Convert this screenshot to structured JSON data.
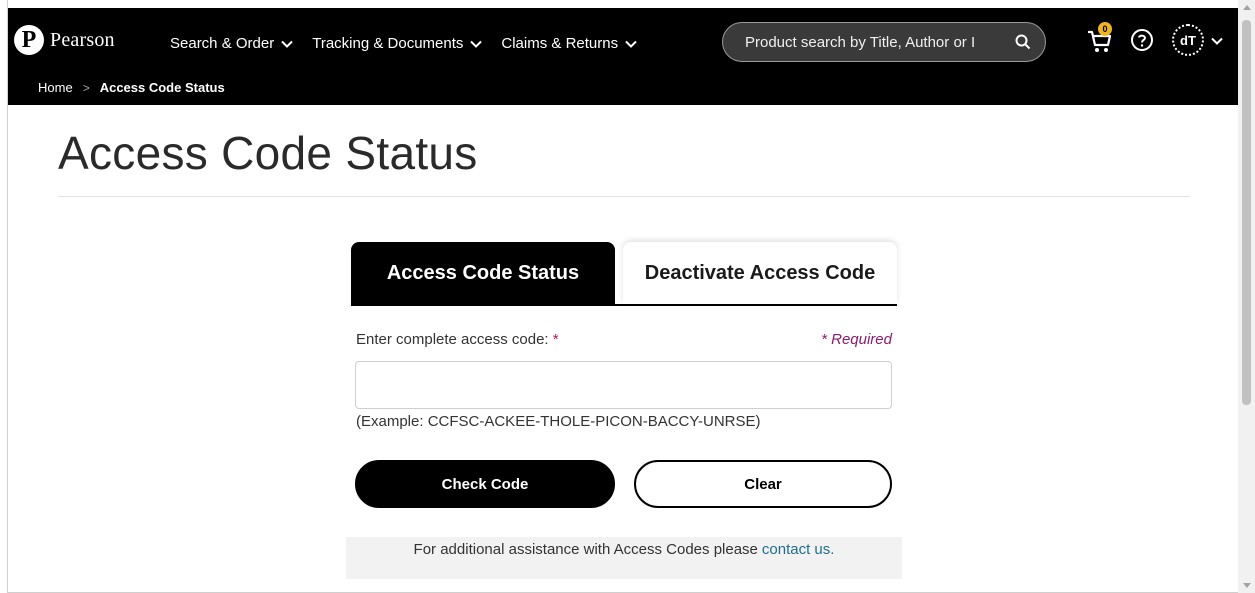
{
  "header": {
    "logo_mark": "P",
    "logo_text": "Pearson",
    "nav": [
      {
        "label": "Search & Order"
      },
      {
        "label": "Tracking & Documents"
      },
      {
        "label": "Claims & Returns"
      }
    ],
    "search_placeholder": "Product search by Title, Author or I",
    "cart_count": "0",
    "avatar_initials": "dT"
  },
  "breadcrumb": {
    "home": "Home",
    "separator": ">",
    "current": "Access Code Status"
  },
  "page": {
    "title": "Access Code Status"
  },
  "tabs": [
    {
      "label": "Access Code Status",
      "active": true
    },
    {
      "label": "Deactivate Access Code",
      "active": false
    }
  ],
  "form": {
    "label": "Enter complete access code:",
    "label_star": "*",
    "required_note": "* Required",
    "input_value": "",
    "example": "(Example: CCFSC-ACKEE-THOLE-PICON-BACCY-UNRSE)",
    "check_label": "Check Code",
    "clear_label": "Clear"
  },
  "assist": {
    "text": "For additional assistance with Access Codes please",
    "link": "contact us."
  },
  "colors": {
    "header_bg": "#000000",
    "link": "#1f6f8b",
    "required": "#8a1c6e",
    "badge": "#f0b323"
  },
  "icons": {
    "search": "search-icon",
    "cart": "cart-icon",
    "help": "help-icon",
    "chevron": "chevron-down-icon"
  }
}
